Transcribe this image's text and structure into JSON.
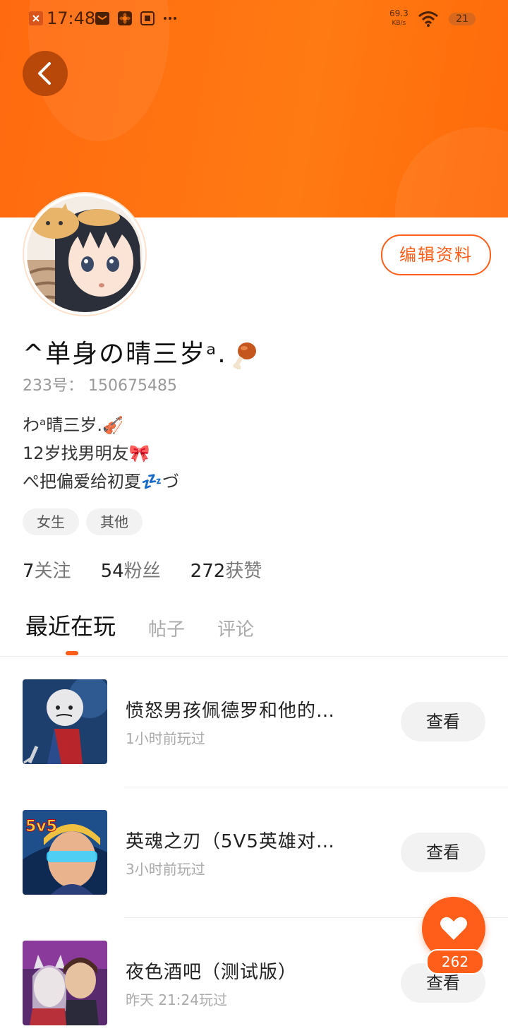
{
  "status_bar": {
    "time": "17:48",
    "net_speed_value": "69.3",
    "net_speed_unit": "KB/s",
    "battery": "21",
    "icons": [
      "app-icon",
      "mail-icon",
      "fan-icon",
      "screen-icon",
      "more-icon",
      "wifi-icon",
      "battery-icon"
    ]
  },
  "header": {
    "back_icon": "back-arrow-icon",
    "accent": "#ff6a10"
  },
  "profile": {
    "name": "^单身の晴三岁ᵃ.",
    "uid": "233号： 150675485",
    "edit_label": "编辑资料",
    "bio": [
      "わᵃ晴三岁.🎻",
      "12岁找男明友🎀",
      "ぺ把偏爱给初夏💤づ"
    ],
    "tags": [
      "女生",
      "其他"
    ],
    "stats": [
      {
        "num": "7",
        "label": "关注"
      },
      {
        "num": "54",
        "label": "粉丝"
      },
      {
        "num": "272",
        "label": "获赞"
      }
    ]
  },
  "tabs": [
    {
      "label": "最近在玩",
      "active": true
    },
    {
      "label": "帖子",
      "active": false
    },
    {
      "label": "评论",
      "active": false
    }
  ],
  "games": [
    {
      "title": "愤怒男孩佩德罗和他的…",
      "time": "1小时前玩过",
      "button": "查看"
    },
    {
      "title": "英魂之刃（5V5英雄对…",
      "time": "3小时前玩过",
      "button": "查看"
    },
    {
      "title": "夜色酒吧（测试版）",
      "time": "昨天 21:24玩过",
      "button": "查看"
    }
  ],
  "game_icon_text": "5v5",
  "like": {
    "count": "262",
    "icon": "heart-icon"
  }
}
